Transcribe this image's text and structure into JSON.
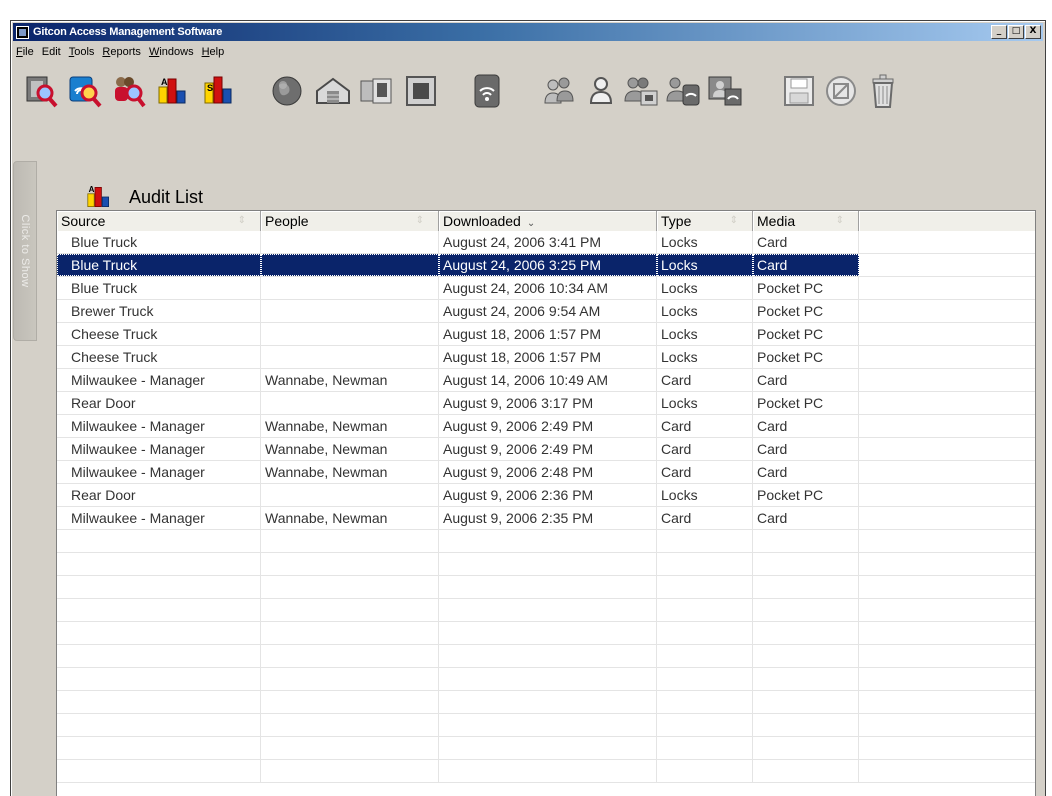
{
  "window": {
    "title": "Gitcon Access Management Software",
    "buttons": {
      "minimize": "_",
      "maximize": "□",
      "close": "X"
    }
  },
  "menu": [
    {
      "label": "File",
      "underline": "F"
    },
    {
      "label": "Edit",
      "underline": ""
    },
    {
      "label": "Tools",
      "underline": "T"
    },
    {
      "label": "Reports",
      "underline": "R"
    },
    {
      "label": "Windows",
      "underline": "W"
    },
    {
      "label": "Help",
      "underline": "H"
    }
  ],
  "toolbar_icons": [
    "search-door-icon",
    "search-wifi-icon",
    "search-people-icon",
    "audit-report-icon",
    "audit-report-alt-icon",
    "globe-icon",
    "building-icon",
    "card-reader-icon",
    "lock-panel-icon",
    "wireless-lock-icon",
    "group-icon",
    "user-icon",
    "group-card-icon",
    "group-wireless-icon",
    "group-network-icon",
    "save-icon",
    "cancel-icon",
    "trash-icon"
  ],
  "sidebar": {
    "label": "Click to Show"
  },
  "panel": {
    "title": "Audit List",
    "icon": "audit-report-icon"
  },
  "table": {
    "columns": [
      "Source",
      "People",
      "Downloaded",
      "Type",
      "Media"
    ],
    "sort_column": "Downloaded",
    "selected_row": 1,
    "rows": [
      [
        "Blue Truck",
        "",
        "August 24, 2006 3:41 PM",
        "Locks",
        "Card"
      ],
      [
        "Blue Truck",
        "",
        "August 24, 2006 3:25 PM",
        "Locks",
        "Card"
      ],
      [
        "Blue Truck",
        "",
        "August 24, 2006 10:34 AM",
        "Locks",
        "Pocket PC"
      ],
      [
        "Brewer Truck",
        "",
        "August 24, 2006 9:54 AM",
        "Locks",
        "Pocket PC"
      ],
      [
        "Cheese Truck",
        "",
        "August 18, 2006 1:57 PM",
        "Locks",
        "Pocket PC"
      ],
      [
        "Cheese Truck",
        "",
        "August 18, 2006 1:57 PM",
        "Locks",
        "Pocket PC"
      ],
      [
        "Milwaukee - Manager",
        "Wannabe, Newman",
        "August 14, 2006 10:49 AM",
        "Card",
        "Card"
      ],
      [
        "Rear Door",
        "",
        "August 9, 2006 3:17 PM",
        "Locks",
        "Pocket PC"
      ],
      [
        "Milwaukee - Manager",
        "Wannabe, Newman",
        "August 9, 2006 2:49 PM",
        "Card",
        "Card"
      ],
      [
        "Milwaukee - Manager",
        "Wannabe, Newman",
        "August 9, 2006 2:49 PM",
        "Card",
        "Card"
      ],
      [
        "Milwaukee - Manager",
        "Wannabe, Newman",
        "August 9, 2006 2:48 PM",
        "Card",
        "Card"
      ],
      [
        "Rear Door",
        "",
        "August 9, 2006 2:36 PM",
        "Locks",
        "Pocket PC"
      ],
      [
        "Milwaukee - Manager",
        "Wannabe, Newman",
        "August 9, 2006 2:35 PM",
        "Card",
        "Card"
      ]
    ]
  },
  "colors": {
    "selection": "#0a246a",
    "titlebar_start": "#0a246a",
    "titlebar_end": "#a6caf0",
    "window_bg": "#d4d0c8"
  }
}
